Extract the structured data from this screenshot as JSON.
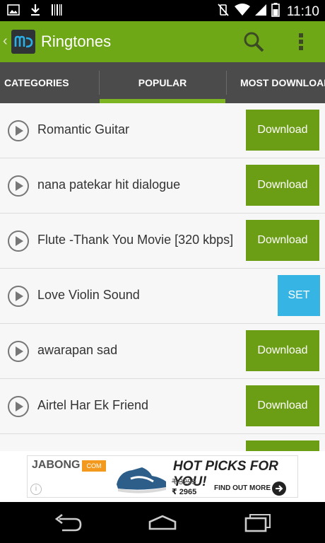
{
  "status_bar": {
    "time": "11:10",
    "left_icons": [
      "image-icon",
      "download-icon",
      "barcode-icon"
    ],
    "right_icons": [
      "vibrate-mute-icon",
      "wifi-icon",
      "signal-icon",
      "battery-icon"
    ]
  },
  "app_bar": {
    "title": "Ringtones",
    "logo_text": "m",
    "icons": [
      "back-icon",
      "app-logo",
      "search-icon",
      "overflow-menu-icon"
    ]
  },
  "tabs": [
    {
      "label": "CATEGORIES",
      "active": false
    },
    {
      "label": "POPULAR",
      "active": true
    },
    {
      "label": "MOST DOWNLOADED",
      "active": false
    }
  ],
  "ringtones": [
    {
      "title": "Romantic Guitar",
      "action": "Download",
      "action_type": "download"
    },
    {
      "title": "nana patekar hit dialogue",
      "action": "Download",
      "action_type": "download"
    },
    {
      "title": "Flute -Thank You Movie [320 kbps]",
      "action": "Download",
      "action_type": "download"
    },
    {
      "title": "Love Violin Sound",
      "action": "SET",
      "action_type": "set"
    },
    {
      "title": "awarapan sad",
      "action": "Download",
      "action_type": "download"
    },
    {
      "title": "Airtel Har Ek Friend",
      "action": "Download",
      "action_type": "download"
    }
  ],
  "ad": {
    "brand": "JABONG",
    "brand_tag": "COM",
    "headline": "HOT PICKS FOR YOU!",
    "old_price": "₹ 3295",
    "new_price": "₹ 2965",
    "cta": "FIND OUT MORE",
    "info_label": "i"
  },
  "nav_bar": {
    "icons": [
      "back-nav-icon",
      "home-nav-icon",
      "recent-apps-icon"
    ]
  },
  "colors": {
    "accent_green": "#6fa816",
    "download_button": "#6b9e14",
    "set_button": "#36b5e5",
    "tab_bar": "#4b4b4b",
    "tab_indicator": "#7cb521"
  }
}
